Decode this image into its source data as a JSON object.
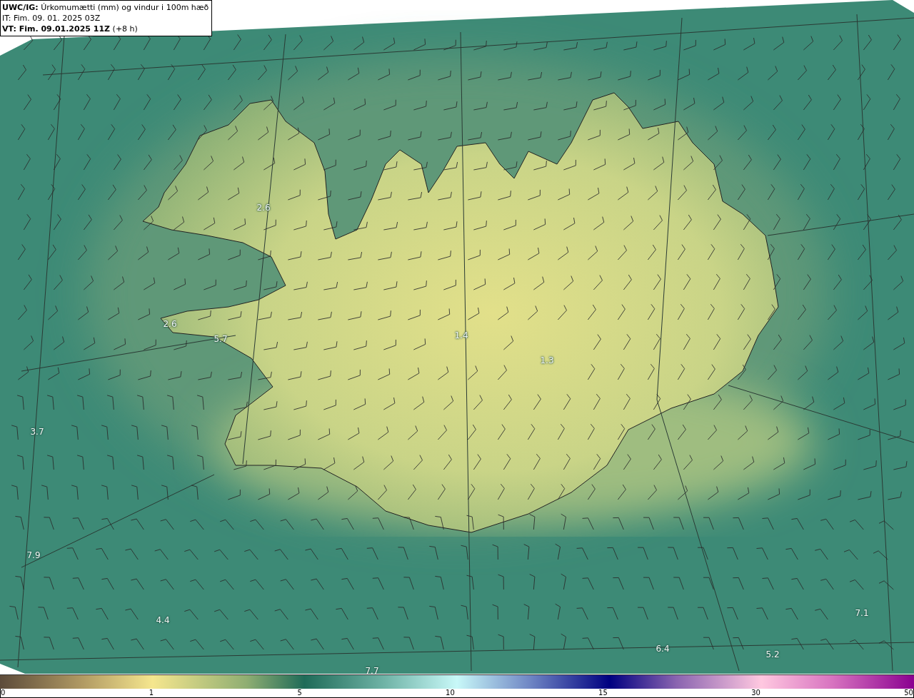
{
  "header": {
    "title": "**UWC/IG:** Úrkomumætti (mm) og vindur i 100m hæð",
    "issue_time": "IT: Fim. 09. 01. 2025 03Z",
    "valid_time": "**VT: Fim. 09.01.2025 11Z** (+8 h)"
  },
  "map": {
    "value_labels": [
      "2.6",
      "2.6",
      "5.7",
      "1.4",
      "1.3",
      "3.7",
      "7.9",
      "4.4",
      "6.4",
      "5.2",
      "7.1",
      "7.7"
    ]
  },
  "colorbar": {
    "ticks": [
      "0",
      "1",
      "5",
      "10",
      "15",
      "30",
      "50"
    ]
  }
}
